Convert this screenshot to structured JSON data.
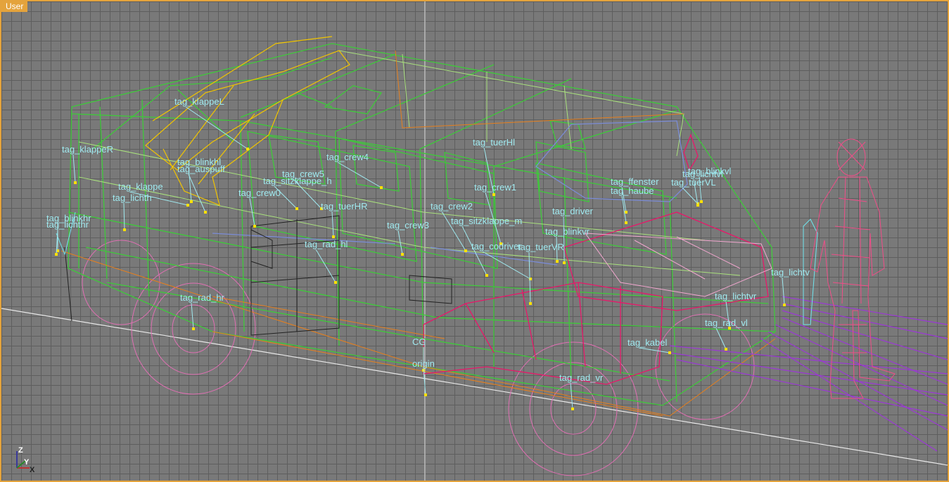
{
  "viewport": {
    "label": "User",
    "colors": {
      "frame": "#e4a33c",
      "grid_bg": "#797979",
      "grid_line": "#5e5e5e",
      "tag_text": "#9fe9ef",
      "tag_point": "#ffe100"
    }
  },
  "tags": [
    "tag_klappeL",
    "tag_klappeR",
    "tag_blinkhl",
    "tag_auspuff",
    "tag_klappe",
    "tag_lichth",
    "tag_blinkhr",
    "tag_lichthr",
    "tag_crew4",
    "tag_crew5",
    "tag_sitzklappe_h",
    "tag_crew0",
    "tag_tuerHR",
    "tag_rad_hl",
    "tag_rad_hr",
    "tag_tuerHl",
    "tag_crew1",
    "tag_crew2",
    "tag_crew3",
    "tag_sitzklappe_m",
    "tag_codriver",
    "tag_tuerVR",
    "tag_driver",
    "tag_blinkvr",
    "tag_ffenster",
    "tag_tuerVL",
    "tag_haube",
    "tag_blinkvl",
    "tag_lichtvl",
    "tag_lichtvr",
    "tag_lichtv",
    "tag_rad_vl",
    "tag_kabel",
    "tag_rad_vr",
    "CG",
    "origin"
  ],
  "gizmo": {
    "z": "Z",
    "y": "Y",
    "x": "X"
  }
}
